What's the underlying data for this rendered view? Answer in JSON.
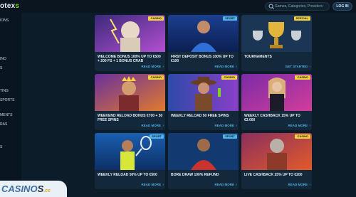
{
  "header": {
    "logo": "otex",
    "logo_dot": "s",
    "search_placeholder": "Games, Categories, Providers",
    "login_label": "LOG IN"
  },
  "sidebar": {
    "items": [
      "IONS",
      "INO",
      "S",
      "TING",
      "SPORTS",
      "MENTS",
      "RAS",
      "S"
    ]
  },
  "cards": [
    {
      "title": "WELCOME BONUS 100% UP TO €500 + 200 FS + 1 BONUS CRAB",
      "badge": "CASINO",
      "action": "READ MORE"
    },
    {
      "title": "FIRST DEPOSIT BONUS 100% UP TO €100",
      "badge": "SPORT",
      "action": "READ MORE"
    },
    {
      "title": "TOURNAMENTS",
      "badge": "SPECIAL",
      "action": "GET STARTED"
    },
    {
      "title": "WEEKEND RELOAD BONUS €700 + 50 FREE SPINS",
      "badge": "CASINO",
      "action": "READ MORE"
    },
    {
      "title": "WEEKLY RELOAD 50 FREE SPINS",
      "badge": "CASINO",
      "action": "READ MORE"
    },
    {
      "title": "WEEKLY CASHBACK 15% UP TO €3.000",
      "badge": "CASINO",
      "action": "READ MORE"
    },
    {
      "title": "WEEKLY RELOAD 50% UP TO €500",
      "badge": "SPORT",
      "action": "READ MORE"
    },
    {
      "title": "BORE DRAW 100% REFUND",
      "badge": "SPORT",
      "action": "READ MORE"
    },
    {
      "title": "LIVE CASHBACK 25% UP TO €200",
      "badge": "CASINO",
      "action": "READ MORE"
    }
  ],
  "badge_colors": {
    "CASINO": "#f5d23b",
    "SPORT": "#4fb3e8",
    "SPECIAL": "#f5d23b"
  },
  "watermark": {
    "text": "CASINO",
    "suffix": "S",
    "cc": ".cc"
  }
}
